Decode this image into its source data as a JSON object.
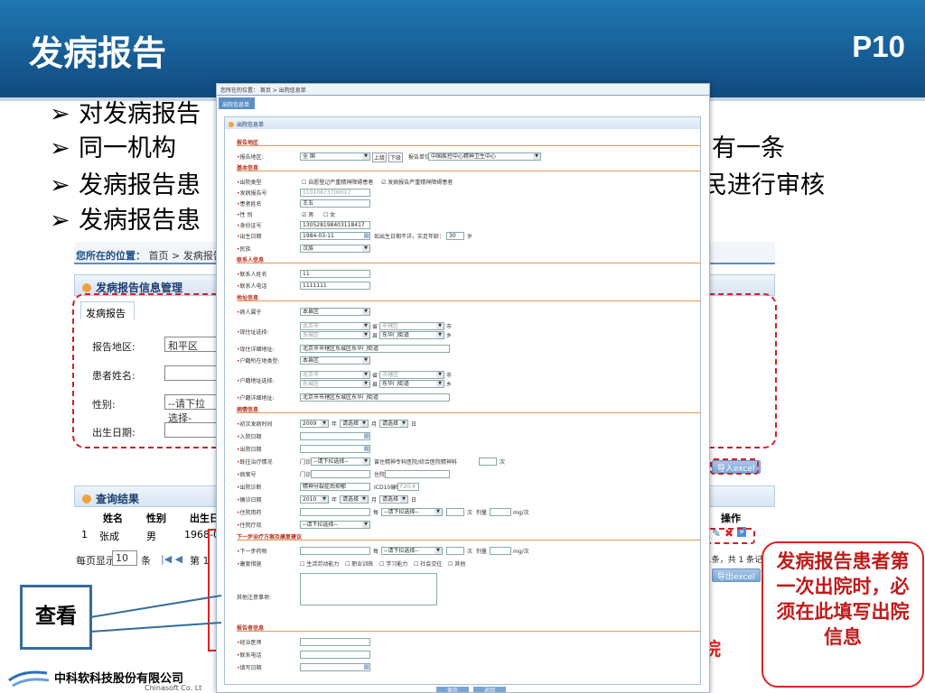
{
  "slide": {
    "title": "发病报告",
    "page": "P10"
  },
  "bullets": [
    {
      "marker": "➢",
      "text": "对发病报告",
      "tail": ""
    },
    {
      "marker": "➢",
      "text": "同一机构",
      "tail": "有一条"
    },
    {
      "marker": "➢",
      "text": "发病报告患",
      "tail": "民进行审核"
    },
    {
      "marker": "➢",
      "text": "发病报告患",
      "tail": ""
    }
  ],
  "background_page": {
    "breadcrumb_prefix": "您所在的位置：",
    "breadcrumb": "首页 > 发病报告",
    "panel_title": "发病报告信息管理",
    "tab": "发病报告",
    "fields": [
      {
        "label": "报告地区:",
        "value": "和平区"
      },
      {
        "label": "患者姓名:",
        "value": ""
      },
      {
        "label": "性别:",
        "value": "--请下拉选择-"
      },
      {
        "label": "出生日期:",
        "value": ""
      }
    ],
    "import_button": "导入excel",
    "export_button": "导出excel",
    "result_title": "查询结果",
    "columns": [
      "姓名",
      "性别",
      "出生日期",
      "操作"
    ],
    "row": {
      "no": "1",
      "name": "张成",
      "sex": "男",
      "birth": "1968-0"
    },
    "pagination": {
      "per_page_label": "每页显示",
      "per_page": "10",
      "unit": "条",
      "page_label": "第 1",
      "total": "1条，共 1 条记录"
    },
    "red_text": "院"
  },
  "form": {
    "crumb": "您所在的位置：  首页 > 出院信息单",
    "tab": "出院信息单",
    "frame_title": "出院信息单",
    "sections": {
      "report_region": "报告地区",
      "basic": "基本信息",
      "contact": "联系人信息",
      "address": "地址信息",
      "illness": "病情信息",
      "next_steps": "下一步治疗方案及康复建议",
      "reporter": "报告者信息"
    },
    "region": {
      "label": "报告地区:",
      "value": "全    国",
      "up": "上级",
      "down": "下级",
      "unit_label": "报告单位",
      "unit_value": "中国疾控中心精神卫生中心"
    },
    "discharge_type": {
      "label": "出院类型",
      "opt1": "自愿登记严重精神障碍患者",
      "opt2": "发病报告严重精神障碍患者"
    },
    "report_no": {
      "label": "发病报告号",
      "value": "11010873700017"
    },
    "name": {
      "label": "患者姓名",
      "value": "王五"
    },
    "sex": {
      "label": "性  别",
      "male": "男",
      "female": "女"
    },
    "id_no": {
      "label": "身份证号",
      "value": "130528198403118417"
    },
    "birth": {
      "label": "出生日期",
      "value": "1984-03-11",
      "unknown_label": "如出生日期不详，实足年龄：",
      "age": "30",
      "age_unit": "岁"
    },
    "ethnic": {
      "label": "民族",
      "value": "汉族"
    },
    "contact_name": {
      "label": "联系人姓名",
      "value": "11"
    },
    "contact_phone": {
      "label": "联系人电话",
      "value": "1111111"
    },
    "belong": {
      "label": "病人属于",
      "value": "本县区"
    },
    "current_addr": {
      "label": "现住址选择:",
      "l1": "北京市",
      "l2": "东城区",
      "u1": "省",
      "u2": "县",
      "r1": "市辖区",
      "r2": "东华门街道",
      "u3": "市",
      "u4": "乡"
    },
    "current_detail": {
      "label": "现住详细地址:",
      "value": "北京市市辖区东城区东华门街道"
    },
    "hukou_type": {
      "label": "户籍所在地类型:",
      "value": "本县区"
    },
    "hukou_addr": {
      "label": "户籍地址选择:",
      "l1": "北京市",
      "l2": "东城区",
      "u1": "省",
      "u2": "县",
      "r1": "市辖区",
      "r2": "东华门街道",
      "u3": "市",
      "u4": "乡"
    },
    "hukou_detail": {
      "label": "户籍详细地址:",
      "value": "北京市市辖区东城区东华门街道"
    },
    "onset": {
      "label": "初次发病时间",
      "year": "2009",
      "y_unit": "年",
      "month": "请选择",
      "m_unit": "月",
      "day": "请选择",
      "d_unit": "日"
    },
    "admit": {
      "label": "入院日期"
    },
    "discharge": {
      "label": "出院日期"
    },
    "past_treat": {
      "label": "既往治疗情况",
      "outpatient": "门诊",
      "select": "--请下拉选择--",
      "inpatient_label": "曾住精神专科医院/综合医院精神科",
      "times_unit": "次"
    },
    "case_no": {
      "label": "病案号",
      "outpatient": "门诊",
      "inpatient": "住院"
    },
    "diagnosis": {
      "label": "出院诊断",
      "value": "精神分裂症后抑郁",
      "icd_label": "ICD10编码",
      "icd": "F20.4"
    },
    "confirm": {
      "label": "确诊日期",
      "year": "2010",
      "y_unit": "年",
      "month": "请选择",
      "m_unit": "月",
      "day": "请选择",
      "d_unit": "日"
    },
    "drug": {
      "label": "住院用药",
      "mid": "每",
      "select": "--请下拉选择--",
      "times": "次",
      "dose_label": "剂量",
      "dose_unit": "mg/次"
    },
    "effect": {
      "label": "住院疗效",
      "value": "--请下拉选择--"
    },
    "next_drug": {
      "label": "下一步药物",
      "mid": "每",
      "select": "--请下拉选择--",
      "times": "次",
      "dose_label": "剂量",
      "dose_unit": "mg/次"
    },
    "rehab": {
      "label": "康复措施",
      "opts": [
        "生活劳动能力",
        "职业训练",
        "学习能力",
        "社会交往",
        "其他"
      ]
    },
    "notes": {
      "label": "其他注意事项:"
    },
    "doctor": {
      "label": "经治医师"
    },
    "phone": {
      "label": "联系电话"
    },
    "fill_date": {
      "label": "填写日期"
    },
    "save": "保存",
    "cancel": "返回"
  },
  "callout": "发病报告患者第一次出院时，必须在此填写出院信息",
  "look_label": "查看",
  "footer": {
    "company": "中科软科技股份有限公司",
    "english": "Chinasoft Co. Lt"
  },
  "colors": {
    "header": "#1a5f98",
    "accent_red": "#d0202a",
    "form_section": "#b8321f"
  }
}
